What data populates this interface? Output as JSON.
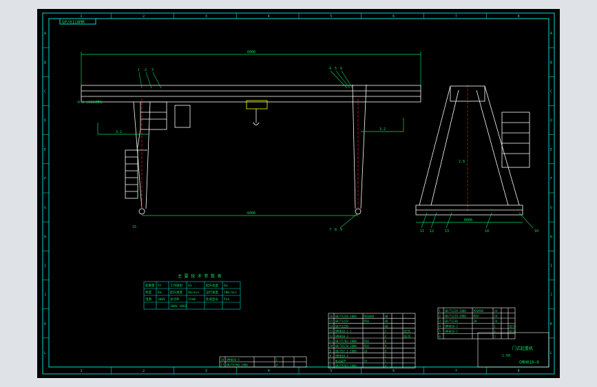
{
  "window": {
    "title": "CAD drawing viewer"
  },
  "colors": {
    "background": "#000000",
    "viewport": "#dfe3e8",
    "frame": "#00d8d8",
    "geometry": "#ffffff",
    "dimension": "#00e060",
    "centerline": "#ff2020",
    "hook_highlight": "#ffff00"
  },
  "frame": {
    "top_zone_numbers": [
      "1",
      "2",
      "3",
      "4",
      "5",
      "6",
      "7",
      "8"
    ],
    "bottom_zone_numbers": [
      "1",
      "2",
      "3",
      "4",
      "5",
      "6",
      "7",
      "8"
    ],
    "left_zone_letters": [
      "A",
      "B",
      "C",
      "D",
      "E",
      "F",
      "G",
      "H",
      "I",
      "J",
      "K",
      "L"
    ],
    "right_zone_letters": [
      "A",
      "B",
      "C",
      "D",
      "E",
      "F",
      "G",
      "H",
      "I",
      "J",
      "K",
      "L"
    ],
    "corner_tag": "GP/0110MM"
  },
  "drawing": {
    "front_view": {
      "span_dimension": "6000",
      "rail_span_dimension": "6000",
      "rail_level_label": "-0.3 (0110MM)",
      "callouts_left": [
        "1",
        "2",
        "3"
      ],
      "callouts_right": [
        "4",
        "5",
        "6"
      ],
      "leg_callout": "15",
      "foot_callouts": [
        "7",
        "8",
        "9"
      ],
      "left_height_dim": "3.2",
      "right_height_dim": "3.2"
    },
    "side_view": {
      "callouts_bottom": [
        "11",
        "12",
        "13",
        "14"
      ],
      "callouts_right": [
        "10"
      ],
      "height_dim": "2.8",
      "base_dim": "6000"
    }
  },
  "tech_table": {
    "title": "主 要 技 术 参 数 表",
    "rows": [
      [
        "起重量",
        "5t",
        "工作级别",
        "A3",
        "起升高度",
        "6m"
      ],
      [
        "跨度",
        "6m",
        "起升速度",
        "8m/min",
        "运行速度",
        "20m/min"
      ],
      [
        "电源",
        "380V",
        "总功率",
        "12kW",
        "轨道型号",
        "P24"
      ],
      [
        "",
        "",
        "380V 50HZ",
        "",
        "",
        ""
      ]
    ]
  },
  "parts_list": {
    "right_block": [
      [
        "1",
        "GB/T1228-2006",
        "M20X80",
        "24",
        "",
        ""
      ],
      [
        "2",
        "GB/T1229-2006",
        "M20",
        "24",
        "",
        ""
      ],
      [
        "3",
        "GB/T1230",
        "20",
        "24",
        "",
        ""
      ],
      [
        "4",
        "GMH010-3",
        "",
        "1",
        "",
        "Q235"
      ],
      [
        "5",
        "GMH010-2",
        "",
        "1",
        "",
        "Q235"
      ],
      [
        "6",
        "",
        "",
        "2",
        "",
        ""
      ]
    ],
    "left_block": [
      [
        "16",
        "GB/T1228-2006",
        "M20X60",
        "48",
        "",
        ""
      ],
      [
        "15",
        "GB/T1229",
        "M20",
        "48",
        "",
        ""
      ],
      [
        "14",
        "GB/T1230",
        "",
        "48",
        "",
        ""
      ],
      [
        "13",
        "GMH010-2-1",
        "",
        "2",
        "",
        "Q235"
      ],
      [
        "12",
        "GMH010-3",
        "",
        "2",
        "",
        "Q235"
      ],
      [
        "11",
        "GB/T5782-2000",
        "M16",
        "8",
        "",
        ""
      ],
      [
        "10",
        "GB/T6170-2000",
        "M16",
        "8",
        "",
        ""
      ],
      [
        "9",
        "GB/T97.1-2000",
        "16",
        "8",
        "",
        ""
      ],
      [
        "8",
        "GMH010-4",
        "",
        "1",
        "",
        ""
      ],
      [
        "7",
        "电动葫芦",
        "5t",
        "1",
        "",
        ""
      ],
      [
        "6",
        "GB/T5783-1986",
        "",
        "4",
        "",
        ""
      ]
    ],
    "bottom_rows": [
      [
        "18",
        "GMH010-5",
        "",
        "1",
        "",
        ""
      ],
      [
        "17",
        "GB/T5780-1986",
        "",
        "4",
        "",
        ""
      ]
    ],
    "title_block": {
      "drawing_no": "GMH010-0",
      "name": "门式起重机",
      "scale": "1:50",
      "sheet": "1"
    }
  }
}
